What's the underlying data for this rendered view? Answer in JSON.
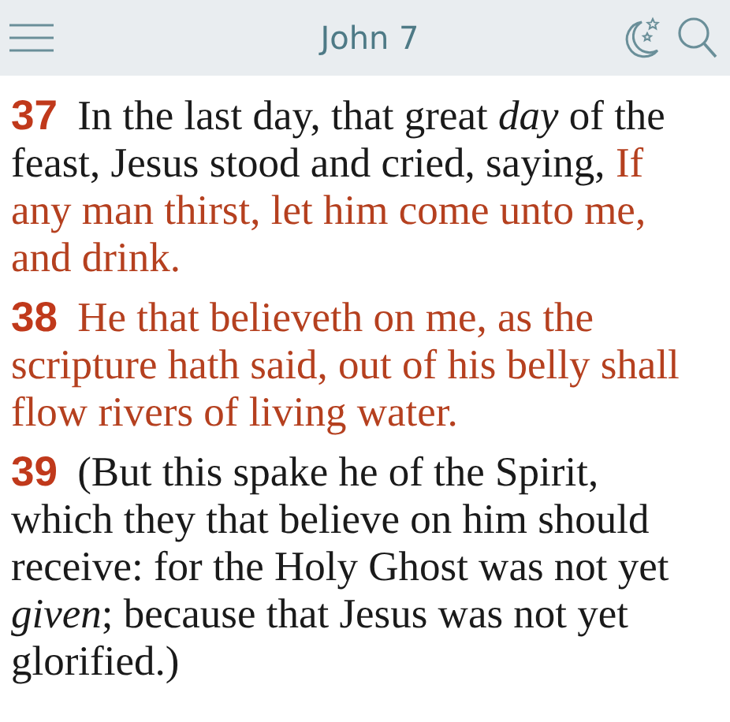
{
  "header": {
    "title": "John 7"
  },
  "verses": [
    {
      "number": "37",
      "segments": [
        {
          "kind": "narration",
          "text": "In the last day, that great *day* of the feast, Jesus stood and cried, saying, "
        },
        {
          "kind": "words_of_christ",
          "text": "If any man thirst, let him come unto me, and drink."
        }
      ]
    },
    {
      "number": "38",
      "segments": [
        {
          "kind": "words_of_christ",
          "text": "He that believeth on me, as the scripture hath said, out of his belly shall flow rivers of living water."
        }
      ]
    },
    {
      "number": "39",
      "segments": [
        {
          "kind": "narration",
          "text": "(But this spake he of the Spirit, which they that believe on him should receive: for the Holy Ghost was not yet *given*; because that Jesus was not yet glorified.)"
        }
      ]
    }
  ]
}
